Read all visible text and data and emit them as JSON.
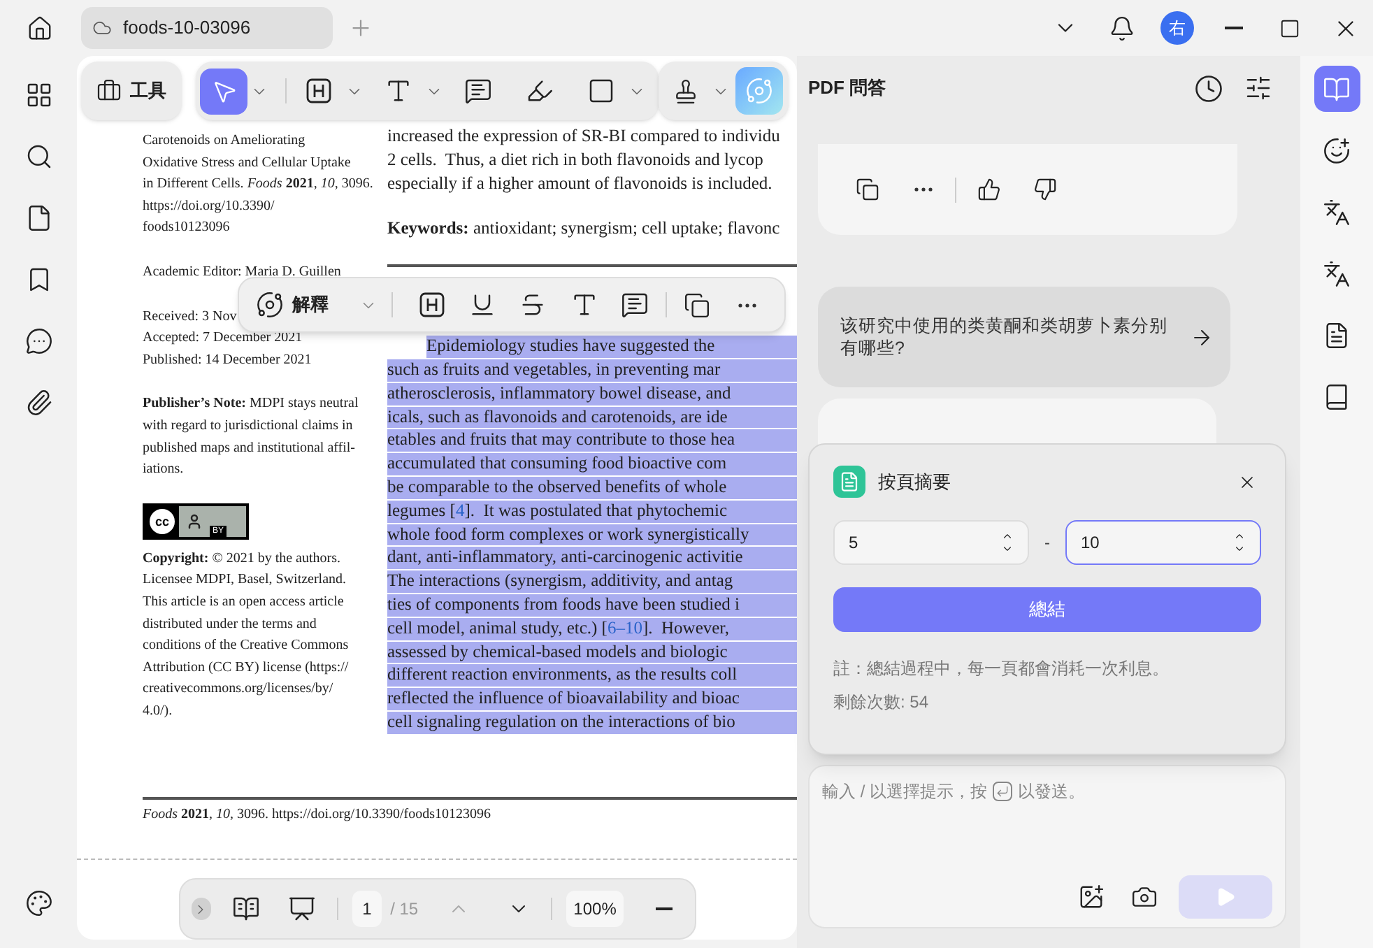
{
  "titlebar": {
    "tabs": [
      {
        "label": "foods-10-03096",
        "selected": true
      }
    ],
    "avatar": "右"
  },
  "top_toolbar": {
    "tools_label": "工具",
    "tools": [
      {
        "selected": true,
        "menu": true
      },
      {
        "selected": false,
        "menu": true
      },
      {
        "selected": false,
        "menu": true
      },
      {
        "selected": false,
        "menu": false
      },
      {
        "selected": false,
        "menu": false
      },
      {
        "selected": false,
        "menu": true
      }
    ]
  },
  "selection_toolbar": {
    "action_label": "解釋"
  },
  "document": {
    "left_column": [
      {
        "kind": "text",
        "lines": [
          "Carotenoids on Ameliorating",
          "Oxidative Stress and Cellular Uptake",
          "in Different Cells. *Foods* **2021**, *10*, 3096.",
          "https://doi.org/10.3390/",
          "foods10123096"
        ]
      },
      {
        "kind": "text",
        "lines": [
          "Academic Editor: Maria D. Guillen"
        ]
      },
      {
        "kind": "text",
        "lines": [
          "Received: 3 Nov",
          "Accepted: 7 December 2021",
          "Published: 14 December 2021"
        ]
      },
      {
        "kind": "text",
        "lines": [
          "**Publisher’s Note:** MDPI stays neutral",
          "with regard to jurisdictional claims in",
          "published maps and institutional affil-",
          "iations."
        ]
      },
      {
        "kind": "license_badge",
        "symbol": "cc",
        "label": "BY"
      },
      {
        "kind": "text",
        "lines": [
          "**Copyright:** © 2021 by the authors.",
          "Licensee MDPI, Basel, Switzerland.",
          "This article is an open access article",
          "distributed under the terms and",
          "conditions of the Creative Commons",
          "Attribution (CC BY) license (https://",
          "creativecommons.org/licenses/by/",
          "4.0/)."
        ]
      }
    ],
    "body_lines": [
      "increased the expression of SR-BI compared to individu",
      "2 cells.  Thus, a diet rich in both flavonoids and lycop",
      "especially if a higher amount of flavonoids is included."
    ],
    "keywords": {
      "label": "Keywords:",
      "text": "antioxidant; synergism; cell uptake; flavonc"
    },
    "paragraph": {
      "selected": true,
      "lines": [
        {
          "text": "Epidemiology studies have suggested the"
        },
        {
          "text": "such as fruits and vegetables, in preventing mar"
        },
        {
          "text": "atherosclerosis, inflammatory bowel disease, and"
        },
        {
          "text": "icals, such as flavonoids and carotenoids, are ide"
        },
        {
          "text": "etables and fruits that may contribute to those hea"
        },
        {
          "text": "accumulated that consuming food bioactive com"
        },
        {
          "text": "be comparable to the observed benefits of whole"
        },
        {
          "text": "legumes [",
          "ref": "4",
          "after": "].  It was postulated that phytochemic"
        },
        {
          "text": "whole food form complexes or work synergistically"
        },
        {
          "text": "dant, anti-inflammatory, anti-carcinogenic activitie"
        },
        {
          "text": "The interactions (synergism, additivity, and antag"
        },
        {
          "text": "ties of components from foods have been studied i"
        },
        {
          "text": "cell model, animal study, etc.) [",
          "ref": "6–10",
          "after": "].  However,"
        },
        {
          "text": "assessed by chemical-based models and biologic"
        },
        {
          "text": "different reaction environments, as the results coll"
        },
        {
          "text": "reflected the influence of bioavailability and bioac"
        },
        {
          "text": "cell signaling regulation on the interactions of bio"
        }
      ]
    },
    "footer": "*Foods* **2021**, *10*, 3096. https://doi.org/10.3390/foods10123096"
  },
  "page_nav": {
    "page": "1",
    "total": "/ 15",
    "zoom": "100%"
  },
  "chat": {
    "title": "PDF 問答",
    "suggestion": "该研究中使用的类黄酮和类胡萝卜素分别有哪些?",
    "input_hint_start": "輸入 / 以選擇提示，按",
    "input_hint_end": "以發送。"
  },
  "summary_dialog": {
    "title": "按頁摘要",
    "from": "5",
    "separator": "-",
    "to": "10",
    "to_focused": true,
    "button": "總結",
    "note": "註：總結過程中，每一頁都會消耗一次利息。",
    "remaining": "剩餘次數: 54"
  },
  "right_rail": [
    {
      "selected": true
    },
    {
      "selected": false
    },
    {
      "selected": false
    },
    {
      "selected": false
    },
    {
      "selected": false
    },
    {
      "selected": false
    }
  ]
}
